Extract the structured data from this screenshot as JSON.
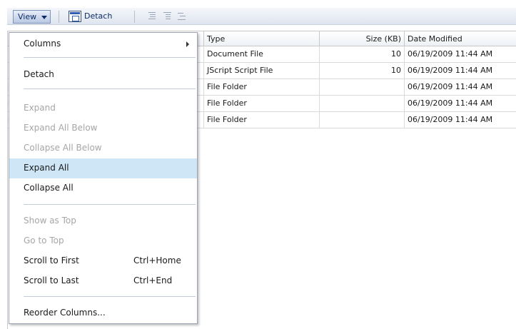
{
  "toolbar": {
    "view_label": "View",
    "detach_label": "Detach",
    "icons": [
      "expand-all-icon",
      "collapse-all-icon",
      "go-up-icon"
    ]
  },
  "table": {
    "columns": [
      "Type",
      "Size (KB)",
      "Date Modified"
    ],
    "rows": [
      {
        "type": "Document File",
        "size": "10",
        "date": "06/19/2009 11:44 AM"
      },
      {
        "type": "JScript Script File",
        "size": "10",
        "date": "06/19/2009 11:44 AM"
      },
      {
        "type": "File Folder",
        "size": "",
        "date": "06/19/2009 11:44 AM"
      },
      {
        "type": "File Folder",
        "size": "",
        "date": "06/19/2009 11:44 AM"
      },
      {
        "type": "File Folder",
        "size": "",
        "date": "06/19/2009 11:44 AM"
      }
    ]
  },
  "menu": {
    "columns": "Columns",
    "detach": "Detach",
    "expand": "Expand",
    "expand_all_below": "Expand All Below",
    "collapse_all_below": "Collapse All Below",
    "expand_all": "Expand All",
    "collapse_all": "Collapse All",
    "show_as_top": "Show as Top",
    "go_to_top": "Go to Top",
    "scroll_to_first": "Scroll to First",
    "scroll_to_first_shortcut": "Ctrl+Home",
    "scroll_to_last": "Scroll to Last",
    "scroll_to_last_shortcut": "Ctrl+End",
    "reorder_columns": "Reorder Columns..."
  },
  "colors": {
    "menu_hover": "#cfe6f7",
    "disabled_text": "#a6a6a6",
    "toolbar_text": "#0d2b66"
  }
}
